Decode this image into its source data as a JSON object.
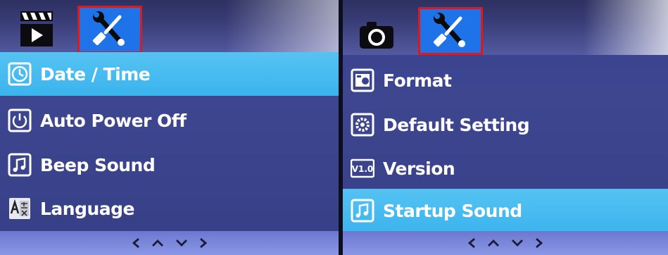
{
  "left_panel": {
    "items": [
      {
        "label": "Date / Time",
        "icon": "clock-icon",
        "selected": true
      },
      {
        "label": "Auto Power Off",
        "icon": "power-icon",
        "selected": false
      },
      {
        "label": "Beep Sound",
        "icon": "music-note-icon",
        "selected": false
      },
      {
        "label": "Language",
        "icon": "language-icon",
        "selected": false
      }
    ]
  },
  "right_panel": {
    "items": [
      {
        "label": "Format",
        "icon": "format-icon",
        "selected": false
      },
      {
        "label": "Default Setting",
        "icon": "default-gear-icon",
        "selected": false
      },
      {
        "label": "Version",
        "icon": "version-icon",
        "selected": false
      },
      {
        "label": "Startup Sound",
        "icon": "music-note-icon",
        "selected": true
      }
    ],
    "version_badge": "V1.0"
  },
  "nav_icons": [
    "chevron-left-icon",
    "chevron-up-icon",
    "chevron-down-icon",
    "chevron-right-icon"
  ],
  "colors": {
    "selected_row": "#3cb4ee",
    "active_tab": "#1e73e8",
    "tab_highlight_border": "#e01818",
    "menu_bg": "#3a4290",
    "footer_bg": "#7a86da"
  }
}
